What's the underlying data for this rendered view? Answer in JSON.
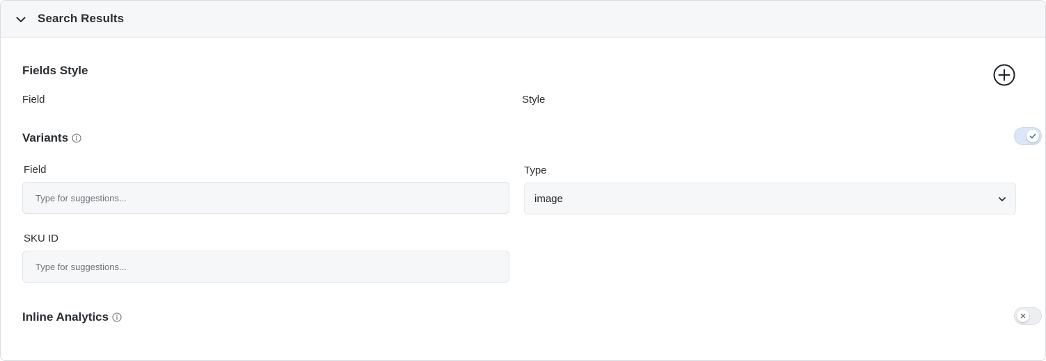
{
  "panel": {
    "title": "Search Results",
    "expanded": true
  },
  "fields_style": {
    "title": "Fields Style",
    "column_field": "Field",
    "column_style": "Style",
    "add_icon": "plus-circle-icon"
  },
  "variants": {
    "title": "Variants",
    "info_icon": "info-icon",
    "enabled": true,
    "field_label": "Field",
    "field_placeholder": "Type for suggestions...",
    "field_value": "",
    "type_label": "Type",
    "type_value": "image",
    "sku_label": "SKU ID",
    "sku_placeholder": "Type for suggestions...",
    "sku_value": ""
  },
  "inline_analytics": {
    "title": "Inline Analytics",
    "info_icon": "info-icon",
    "enabled": false
  },
  "colors": {
    "header_bg": "#f6f7f9",
    "border": "#d8dbe0",
    "toggle_on_bg": "#dbe7f7",
    "toggle_on_check": "#3b6fb6",
    "toggle_off_bg": "#eceef1"
  }
}
